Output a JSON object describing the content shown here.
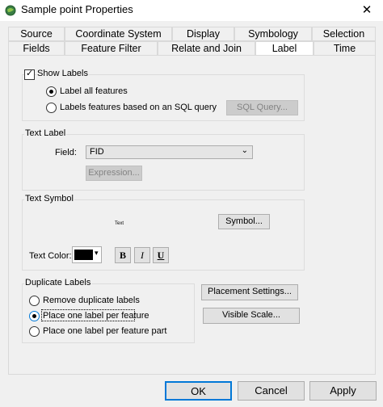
{
  "window": {
    "title": "Sample point  Properties",
    "close_glyph": "✕"
  },
  "tabs_back": [
    "Source",
    "Coordinate System",
    "Display",
    "Symbology",
    "Selection"
  ],
  "tabs_front": [
    "Fields",
    "Feature Filter",
    "Relate and Join",
    "Label",
    "Time"
  ],
  "active_tab": "Label",
  "labels": {
    "show_labels": "Show Labels",
    "show_labels_checked": true,
    "label_all": "Label all features",
    "label_sql": "Labels features based on an SQL query",
    "sql_query_button": "SQL Query...",
    "selected_option": "label_all"
  },
  "text_label": {
    "group": "Text Label",
    "field_label": "Field:",
    "field_value": "FID",
    "expression_button": "Expression..."
  },
  "text_symbol": {
    "group": "Text Symbol",
    "preview": "Text",
    "symbol_button": "Symbol...",
    "color_label": "Text Color:",
    "color": "#000000",
    "bold": "B",
    "italic": "I",
    "underline": "U"
  },
  "duplicates": {
    "group": "Duplicate Labels",
    "options": [
      "Remove duplicate labels",
      "Place one label per feature",
      "Place one label per feature part"
    ],
    "selected": 1
  },
  "side_buttons": {
    "placement": "Placement Settings...",
    "visible_scale": "Visible Scale..."
  },
  "footer": {
    "ok": "OK",
    "cancel": "Cancel",
    "apply": "Apply"
  },
  "colors": {
    "accent": "#0078d7",
    "panel": "#f0f0f0"
  }
}
